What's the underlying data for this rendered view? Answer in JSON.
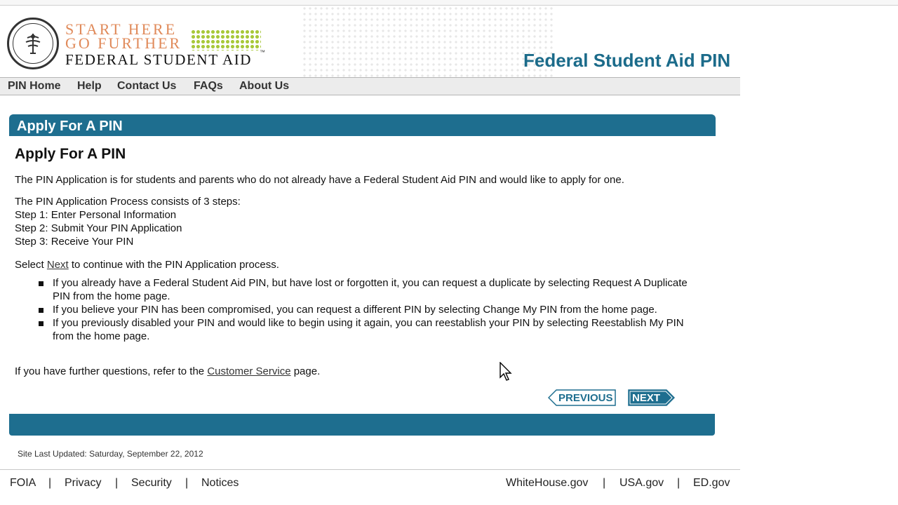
{
  "header": {
    "logo_line1": "START HERE",
    "logo_line2": "GO FURTHER",
    "logo_line3": "FEDERAL STUDENT AID",
    "logo_tm": "™",
    "site_title": "Federal Student Aid PIN"
  },
  "nav": {
    "items": [
      "PIN Home",
      "Help",
      "Contact Us",
      "FAQs",
      "About Us"
    ]
  },
  "panel": {
    "header_title": "Apply For A PIN",
    "heading": "Apply For A PIN",
    "intro": "The PIN Application is for students and parents who do not already have a Federal Student Aid PIN and would like to apply for one.",
    "steps_intro": "The PIN Application Process consists of 3 steps:",
    "steps": [
      "Step 1: Enter Personal Information",
      "Step 2: Submit Your PIN Application",
      "Step 3: Receive Your PIN"
    ],
    "select_prefix": "Select ",
    "select_link": "Next",
    "select_suffix": " to continue with the PIN Application process.",
    "bullets": [
      "If you already have a Federal Student Aid PIN, but have lost or forgotten it, you can request a duplicate by selecting Request A Duplicate PIN from the home page.",
      "If you believe your PIN has been compromised, you can request a different PIN by selecting Change My PIN from the home page.",
      "If you previously disabled your PIN and would like to begin using it again, you can reestablish your PIN by selecting Reestablish My PIN from the home page."
    ],
    "further_prefix": "If you have further questions, refer to the ",
    "further_link": "Customer Service",
    "further_suffix": " page.",
    "previous_button": "PREVIOUS",
    "next_button": "NEXT"
  },
  "footer": {
    "updated": "Site Last Updated: Saturday, September 22, 2012",
    "left_links": [
      "FOIA",
      "Privacy",
      "Security",
      "Notices"
    ],
    "right_links": [
      "WhiteHouse.gov",
      "USA.gov",
      "ED.gov"
    ],
    "separator": "|"
  },
  "colors": {
    "accent": "#1e6e8f",
    "title": "#1b6b8a",
    "logo_orange": "#e08a5a",
    "logo_green": "#a8c83a"
  },
  "icons": {
    "seal": "department-of-education-seal-icon",
    "cursor": "mouse-pointer-icon"
  }
}
